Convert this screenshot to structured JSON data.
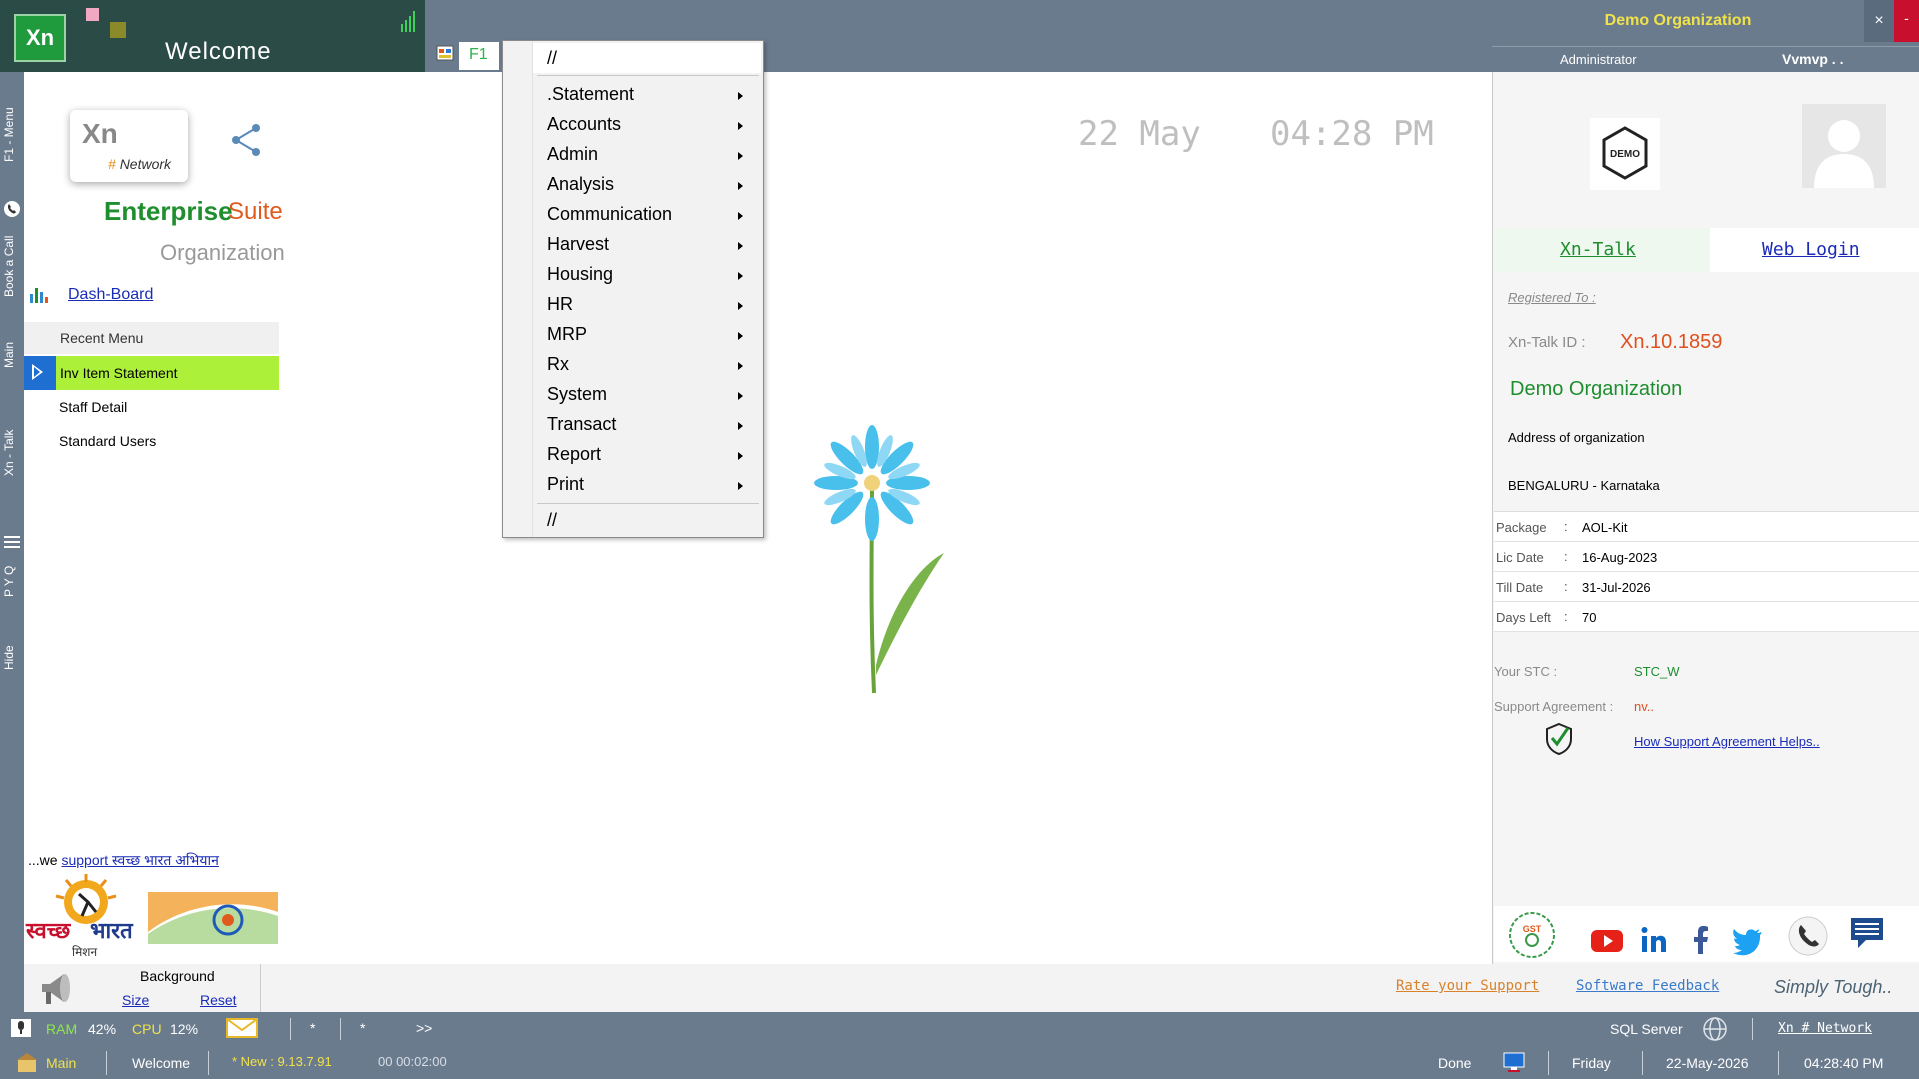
{
  "header": {
    "logo_text": "Xn",
    "title": "Welcome",
    "f1_tab": "F1"
  },
  "side_tabs": [
    "F1 - Menu",
    "Book a Call",
    "Main",
    "Xn - Talk",
    "P Y Q",
    "Hide"
  ],
  "left_panel": {
    "network_card": {
      "xn": "Xn",
      "hash": "#",
      "network": "Network"
    },
    "enterprise": "Enterprise",
    "suite": "Suite",
    "organization": "Organization",
    "dashboard_link": "Dash-Board",
    "recent_menu_title": "Recent Menu",
    "recent_items": [
      "Inv Item Statement",
      "Staff Detail",
      "Standard Users"
    ],
    "swachh_prefix": "...we ",
    "swachh_link": "support स्वच्छ भारत अभियान"
  },
  "center": {
    "date": "22 May",
    "time": "04:28 PM"
  },
  "f1_menu": {
    "top_sep": "//",
    "items": [
      ".Statement",
      "Accounts",
      "Admin",
      "Analysis",
      "Communication",
      "Harvest",
      "Housing",
      "HR",
      "MRP",
      "Rx",
      "System",
      "Transact",
      "Report",
      "Print"
    ],
    "bottom_sep": "//"
  },
  "right_panel": {
    "org_title": "Demo Organization",
    "close": "×",
    "minimize": "-",
    "role": "Administrator",
    "user": "Vvmvp . .",
    "demo_logo": "DEMO",
    "xn_talk": "Xn-Talk",
    "web_login": "Web Login",
    "registered_to": "Registered To :",
    "talk_id_label": "Xn-Talk ID :",
    "talk_id": "Xn.10.1859",
    "org_name": "Demo Organization",
    "address": "Address of organization",
    "city": "BENGALURU - Karnataka",
    "license": [
      {
        "label": "Package",
        "value": "AOL-Kit"
      },
      {
        "label": "Lic Date",
        "value": "16-Aug-2023"
      },
      {
        "label": "Till Date",
        "value": "31-Jul-2026"
      },
      {
        "label": "Days Left",
        "value": "70"
      }
    ],
    "colon": ":",
    "stc_label": "Your STC :",
    "stc_value": "STC_W",
    "support_label": "Support Agreement :",
    "support_value": "nv..",
    "support_help": "How Support Agreement Helps.."
  },
  "bottom_pad": {
    "background": "Background",
    "size": "Size",
    "reset": "Reset",
    "rate_support": "Rate your Support",
    "software_feedback": "Software Feedback",
    "tagline": "Simply Tough.."
  },
  "status1": {
    "ram_label": "RAM",
    "ram_value": "42%",
    "cpu_label": "CPU",
    "cpu_value": "12%",
    "star1": "*",
    "star2": "*",
    "more": ">>",
    "sql": "SQL Server",
    "brand": "Xn # Network"
  },
  "status2": {
    "main": "Main",
    "welcome": "Welcome",
    "new_version": "* New : 9.13.7.91",
    "timer": "00 00:02:00",
    "done": "Done",
    "day": "Friday",
    "date": "22-May-2026",
    "time": "04:28:40 PM"
  },
  "colors": {
    "chrome": "#6b7b8e",
    "accent_green": "#1e8e2e",
    "accent_orange": "#e05a1e",
    "highlight": "#adf03a",
    "link": "#1a2bb8"
  }
}
